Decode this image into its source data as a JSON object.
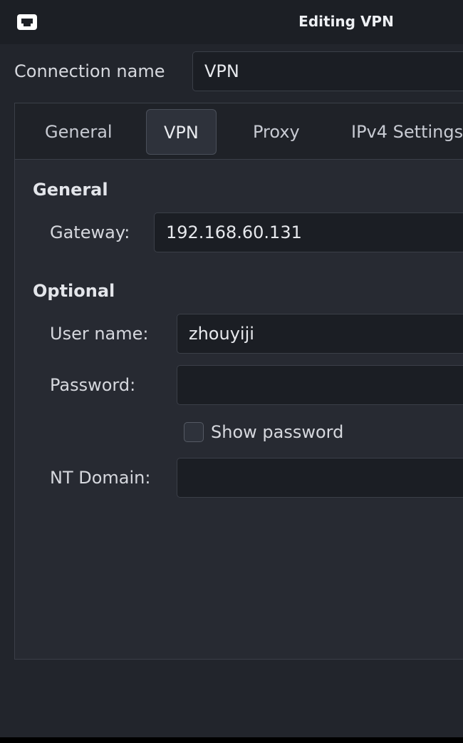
{
  "window": {
    "title": "Editing VPN",
    "app_icon": "network-wired-icon"
  },
  "connection": {
    "label": "Connection name",
    "value": "VPN"
  },
  "tabs": [
    {
      "label": "General",
      "active": false
    },
    {
      "label": "VPN",
      "active": true
    },
    {
      "label": "Proxy",
      "active": false
    },
    {
      "label": "IPv4 Settings",
      "active": false
    }
  ],
  "vpn": {
    "general": {
      "heading": "General",
      "gateway_label": "Gateway:",
      "gateway_value": "192.168.60.131"
    },
    "optional": {
      "heading": "Optional",
      "username_label": "User name:",
      "username_value": "zhouyiji",
      "password_label": "Password:",
      "password_value": "",
      "show_password_label": "Show password",
      "show_password_checked": false,
      "nt_domain_label": "NT Domain:",
      "nt_domain_value": ""
    }
  }
}
